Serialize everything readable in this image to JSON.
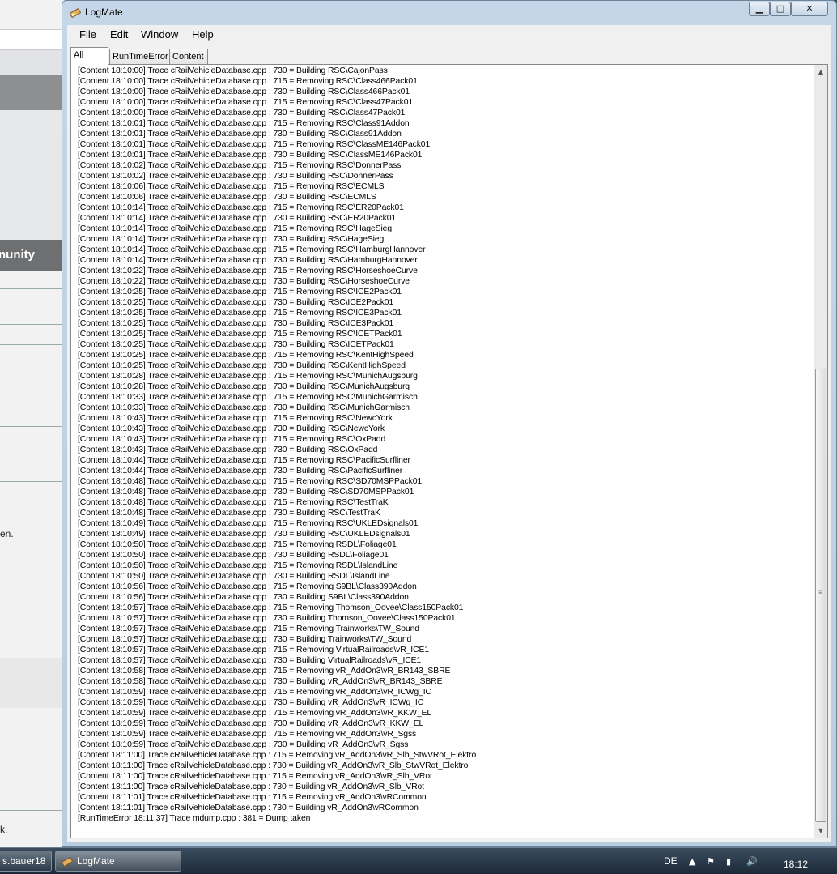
{
  "background_app": {
    "community_label": "nunity",
    "text_en": "en.",
    "text_k": "k."
  },
  "window": {
    "title": "LogMate",
    "controls": {
      "minimize": "▁",
      "maximize": "□",
      "close": "✕"
    }
  },
  "menu": [
    "File",
    "Edit",
    "Window",
    "Help"
  ],
  "tabs": [
    {
      "label": "All",
      "active": true
    },
    {
      "label": "RunTimeError",
      "active": false
    },
    {
      "label": "Content",
      "active": false
    }
  ],
  "log_lines": [
    "[Content 18:10:00] Trace cRailVehicleDatabase.cpp : 730 = Building RSC\\CajonPass",
    "[Content 18:10:00] Trace cRailVehicleDatabase.cpp : 715 = Removing RSC\\Class466Pack01",
    "[Content 18:10:00] Trace cRailVehicleDatabase.cpp : 730 = Building RSC\\Class466Pack01",
    "[Content 18:10:00] Trace cRailVehicleDatabase.cpp : 715 = Removing RSC\\Class47Pack01",
    "[Content 18:10:00] Trace cRailVehicleDatabase.cpp : 730 = Building RSC\\Class47Pack01",
    "[Content 18:10:01] Trace cRailVehicleDatabase.cpp : 715 = Removing RSC\\Class91Addon",
    "[Content 18:10:01] Trace cRailVehicleDatabase.cpp : 730 = Building RSC\\Class91Addon",
    "[Content 18:10:01] Trace cRailVehicleDatabase.cpp : 715 = Removing RSC\\ClassME146Pack01",
    "[Content 18:10:01] Trace cRailVehicleDatabase.cpp : 730 = Building RSC\\ClassME146Pack01",
    "[Content 18:10:02] Trace cRailVehicleDatabase.cpp : 715 = Removing RSC\\DonnerPass",
    "[Content 18:10:02] Trace cRailVehicleDatabase.cpp : 730 = Building RSC\\DonnerPass",
    "[Content 18:10:06] Trace cRailVehicleDatabase.cpp : 715 = Removing RSC\\ECMLS",
    "[Content 18:10:06] Trace cRailVehicleDatabase.cpp : 730 = Building RSC\\ECMLS",
    "[Content 18:10:14] Trace cRailVehicleDatabase.cpp : 715 = Removing RSC\\ER20Pack01",
    "[Content 18:10:14] Trace cRailVehicleDatabase.cpp : 730 = Building RSC\\ER20Pack01",
    "[Content 18:10:14] Trace cRailVehicleDatabase.cpp : 715 = Removing RSC\\HageSieg",
    "[Content 18:10:14] Trace cRailVehicleDatabase.cpp : 730 = Building RSC\\HageSieg",
    "[Content 18:10:14] Trace cRailVehicleDatabase.cpp : 715 = Removing RSC\\HamburgHannover",
    "[Content 18:10:14] Trace cRailVehicleDatabase.cpp : 730 = Building RSC\\HamburgHannover",
    "[Content 18:10:22] Trace cRailVehicleDatabase.cpp : 715 = Removing RSC\\HorseshoeCurve",
    "[Content 18:10:22] Trace cRailVehicleDatabase.cpp : 730 = Building RSC\\HorseshoeCurve",
    "[Content 18:10:25] Trace cRailVehicleDatabase.cpp : 715 = Removing RSC\\ICE2Pack01",
    "[Content 18:10:25] Trace cRailVehicleDatabase.cpp : 730 = Building RSC\\ICE2Pack01",
    "[Content 18:10:25] Trace cRailVehicleDatabase.cpp : 715 = Removing RSC\\ICE3Pack01",
    "[Content 18:10:25] Trace cRailVehicleDatabase.cpp : 730 = Building RSC\\ICE3Pack01",
    "[Content 18:10:25] Trace cRailVehicleDatabase.cpp : 715 = Removing RSC\\ICETPack01",
    "[Content 18:10:25] Trace cRailVehicleDatabase.cpp : 730 = Building RSC\\ICETPack01",
    "[Content 18:10:25] Trace cRailVehicleDatabase.cpp : 715 = Removing RSC\\KentHighSpeed",
    "[Content 18:10:25] Trace cRailVehicleDatabase.cpp : 730 = Building RSC\\KentHighSpeed",
    "[Content 18:10:28] Trace cRailVehicleDatabase.cpp : 715 = Removing RSC\\MunichAugsburg",
    "[Content 18:10:28] Trace cRailVehicleDatabase.cpp : 730 = Building RSC\\MunichAugsburg",
    "[Content 18:10:33] Trace cRailVehicleDatabase.cpp : 715 = Removing RSC\\MunichGarmisch",
    "[Content 18:10:33] Trace cRailVehicleDatabase.cpp : 730 = Building RSC\\MunichGarmisch",
    "[Content 18:10:43] Trace cRailVehicleDatabase.cpp : 715 = Removing RSC\\NewcYork",
    "[Content 18:10:43] Trace cRailVehicleDatabase.cpp : 730 = Building RSC\\NewcYork",
    "[Content 18:10:43] Trace cRailVehicleDatabase.cpp : 715 = Removing RSC\\OxPadd",
    "[Content 18:10:43] Trace cRailVehicleDatabase.cpp : 730 = Building RSC\\OxPadd",
    "[Content 18:10:44] Trace cRailVehicleDatabase.cpp : 715 = Removing RSC\\PacificSurfliner",
    "[Content 18:10:44] Trace cRailVehicleDatabase.cpp : 730 = Building RSC\\PacificSurfliner",
    "[Content 18:10:48] Trace cRailVehicleDatabase.cpp : 715 = Removing RSC\\SD70MSPPack01",
    "[Content 18:10:48] Trace cRailVehicleDatabase.cpp : 730 = Building RSC\\SD70MSPPack01",
    "[Content 18:10:48] Trace cRailVehicleDatabase.cpp : 715 = Removing RSC\\TestTraK",
    "[Content 18:10:48] Trace cRailVehicleDatabase.cpp : 730 = Building RSC\\TestTraK",
    "[Content 18:10:49] Trace cRailVehicleDatabase.cpp : 715 = Removing RSC\\UKLEDsignals01",
    "[Content 18:10:49] Trace cRailVehicleDatabase.cpp : 730 = Building RSC\\UKLEDsignals01",
    "[Content 18:10:50] Trace cRailVehicleDatabase.cpp : 715 = Removing RSDL\\Foliage01",
    "[Content 18:10:50] Trace cRailVehicleDatabase.cpp : 730 = Building RSDL\\Foliage01",
    "[Content 18:10:50] Trace cRailVehicleDatabase.cpp : 715 = Removing RSDL\\IslandLine",
    "[Content 18:10:50] Trace cRailVehicleDatabase.cpp : 730 = Building RSDL\\IslandLine",
    "[Content 18:10:56] Trace cRailVehicleDatabase.cpp : 715 = Removing S9BL\\Class390Addon",
    "[Content 18:10:56] Trace cRailVehicleDatabase.cpp : 730 = Building S9BL\\Class390Addon",
    "[Content 18:10:57] Trace cRailVehicleDatabase.cpp : 715 = Removing Thomson_Oovee\\Class150Pack01",
    "[Content 18:10:57] Trace cRailVehicleDatabase.cpp : 730 = Building Thomson_Oovee\\Class150Pack01",
    "[Content 18:10:57] Trace cRailVehicleDatabase.cpp : 715 = Removing Trainworks\\TW_Sound",
    "[Content 18:10:57] Trace cRailVehicleDatabase.cpp : 730 = Building Trainworks\\TW_Sound",
    "[Content 18:10:57] Trace cRailVehicleDatabase.cpp : 715 = Removing VirtualRailroads\\vR_ICE1",
    "[Content 18:10:57] Trace cRailVehicleDatabase.cpp : 730 = Building VirtualRailroads\\vR_ICE1",
    "[Content 18:10:58] Trace cRailVehicleDatabase.cpp : 715 = Removing vR_AddOn3\\vR_BR143_SBRE",
    "[Content 18:10:58] Trace cRailVehicleDatabase.cpp : 730 = Building vR_AddOn3\\vR_BR143_SBRE",
    "[Content 18:10:59] Trace cRailVehicleDatabase.cpp : 715 = Removing vR_AddOn3\\vR_ICWg_IC",
    "[Content 18:10:59] Trace cRailVehicleDatabase.cpp : 730 = Building vR_AddOn3\\vR_ICWg_IC",
    "[Content 18:10:59] Trace cRailVehicleDatabase.cpp : 715 = Removing vR_AddOn3\\vR_KKW_EL",
    "[Content 18:10:59] Trace cRailVehicleDatabase.cpp : 730 = Building vR_AddOn3\\vR_KKW_EL",
    "[Content 18:10:59] Trace cRailVehicleDatabase.cpp : 715 = Removing vR_AddOn3\\vR_Sgss",
    "[Content 18:10:59] Trace cRailVehicleDatabase.cpp : 730 = Building vR_AddOn3\\vR_Sgss",
    "[Content 18:11:00] Trace cRailVehicleDatabase.cpp : 715 = Removing vR_AddOn3\\vR_Slb_StwVRot_Elektro",
    "[Content 18:11:00] Trace cRailVehicleDatabase.cpp : 730 = Building vR_AddOn3\\vR_Slb_StwVRot_Elektro",
    "[Content 18:11:00] Trace cRailVehicleDatabase.cpp : 715 = Removing vR_AddOn3\\vR_Slb_VRot",
    "[Content 18:11:00] Trace cRailVehicleDatabase.cpp : 730 = Building vR_AddOn3\\vR_Slb_VRot",
    "[Content 18:11:01] Trace cRailVehicleDatabase.cpp : 715 = Removing vR_AddOn3\\vRCommon",
    "[Content 18:11:01] Trace cRailVehicleDatabase.cpp : 730 = Building vR_AddOn3\\vRCommon",
    "[RunTimeError 18:11:37] Trace mdump.cpp : 381 = Dump taken"
  ],
  "scrollbar": {
    "up": "▲",
    "down": "▼",
    "grip": "≡"
  },
  "taskbar": {
    "task1_label": "s.bauer18",
    "task2_label": "LogMate",
    "language": "DE",
    "clock": "18:12",
    "tray_icons": [
      "show-hidden-icon",
      "action-center-flag-icon",
      "network-signal-icon",
      "volume-icon"
    ]
  },
  "colors": {
    "window_frame": "#c5d6e8",
    "log_background": "#ffffff",
    "taskbar": "#1d2a38"
  }
}
